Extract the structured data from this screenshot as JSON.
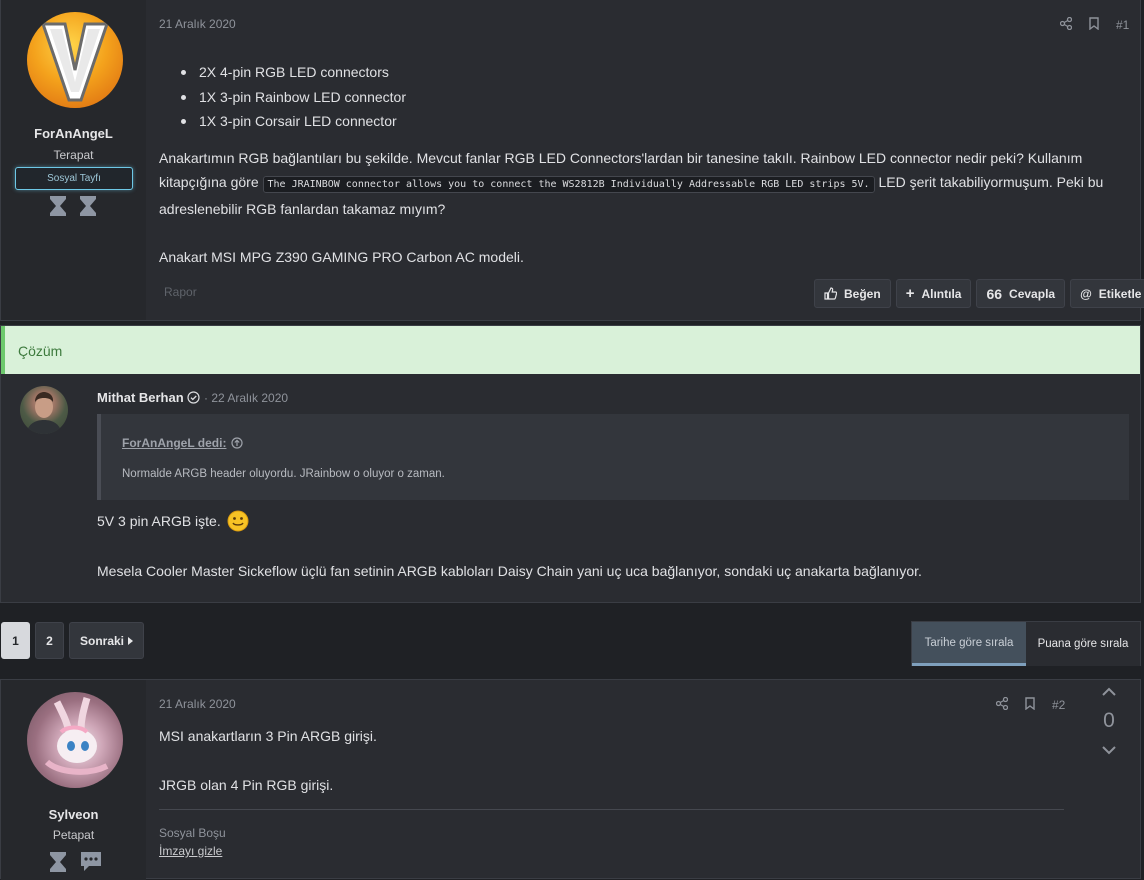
{
  "post1": {
    "author": "ForAnAngeL",
    "user_title": "Terapat",
    "banner": "Sosyal Tayfı",
    "date": "21 Aralık 2020",
    "post_number": "#1",
    "bullets": [
      "2X 4-pin RGB LED connectors",
      "1X 3-pin Rainbow LED connector",
      "1X 3-pin Corsair LED connector"
    ],
    "para1_a": "Anakartımın RGB bağlantıları bu şekilde. Mevcut fanlar RGB LED Connectors'lardan bir tanesine takılı. Rainbow LED connector nedir peki? Kullanım kitapçığına göre ",
    "para1_code": "The JRAINBOW connector allows you to connect the WS2812B Individually Addressable RGB LED strips 5V.",
    "para1_b": " LED şerit takabiliyormuşum. Peki bu adreslenebilir RGB fanlardan takamaz mıyım?",
    "para2": "Anakart MSI MPG Z390 GAMING PRO Carbon AC modeli.",
    "report": "Rapor",
    "buttons": {
      "like": "Beğen",
      "quote": "Alıntıla",
      "reply": "Cevapla",
      "tag": "Etiketle"
    }
  },
  "solution": {
    "header": "Çözüm",
    "author": "Mithat Berhan",
    "date": "· 22 Aralık 2020",
    "quote_source": "ForAnAngeL dedi:",
    "quote_text": "Normalde ARGB header oluyordu. JRainbow o oluyor o zaman.",
    "body1": "5V 3 pin ARGB işte.",
    "body2": "Mesela Cooler Master Sickeflow üçlü fan setinin ARGB kabloları Daisy Chain yani uç uca bağlanıyor, sondaki uç anakarta bağlanıyor."
  },
  "pagination": {
    "page1": "1",
    "page2": "2",
    "next": "Sonraki"
  },
  "sort": {
    "by_date": "Tarihe göre sırala",
    "by_score": "Puana göre sırala"
  },
  "post2": {
    "author": "Sylveon",
    "user_title": "Petapat",
    "date": "21 Aralık 2020",
    "post_number": "#2",
    "vote_count": "0",
    "body1": "MSI anakartların 3 Pin ARGB girişi.",
    "body2": "JRGB olan 4 Pin RGB girişi.",
    "signature": "Sosyal Boşu",
    "hide_signature": "İmzayı gizle"
  },
  "colors": {
    "solution_bg": "#d9f1d9",
    "solution_accent": "#6cc86c",
    "banner_border": "#6ec8e6"
  }
}
